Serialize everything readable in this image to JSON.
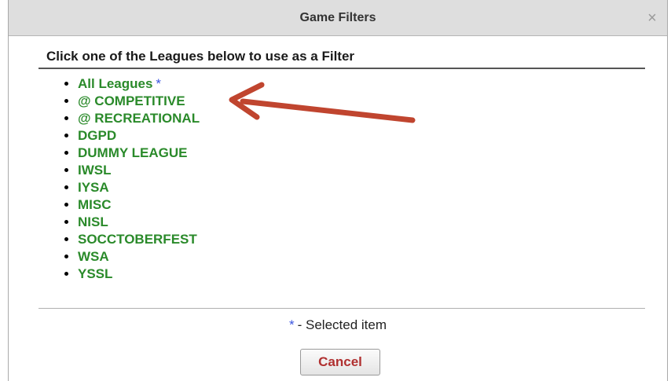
{
  "dialog": {
    "title": "Game Filters",
    "close_glyph": "×",
    "instruction": "Click one of the Leagues below to use as a Filter",
    "leagues": [
      {
        "label": "All Leagues",
        "selected_marker": "*"
      },
      {
        "label": "@ COMPETITIVE",
        "selected_marker": ""
      },
      {
        "label": "@ RECREATIONAL",
        "selected_marker": ""
      },
      {
        "label": "DGPD",
        "selected_marker": ""
      },
      {
        "label": "DUMMY LEAGUE",
        "selected_marker": ""
      },
      {
        "label": "IWSL",
        "selected_marker": ""
      },
      {
        "label": "IYSA",
        "selected_marker": ""
      },
      {
        "label": "MISC",
        "selected_marker": ""
      },
      {
        "label": "NISL",
        "selected_marker": ""
      },
      {
        "label": "SOCCTOBERFEST",
        "selected_marker": ""
      },
      {
        "label": "WSA",
        "selected_marker": ""
      },
      {
        "label": "YSSL",
        "selected_marker": ""
      }
    ],
    "legend": {
      "marker": "*",
      "text": "- Selected item"
    },
    "cancel_label": "Cancel"
  },
  "colors": {
    "league_link": "#2a8a2a",
    "selected_marker": "#3a55e0",
    "annotation_arrow": "#c0452f",
    "cancel_text": "#b03030"
  },
  "annotation": {
    "icon": "arrow-pointing-left"
  }
}
